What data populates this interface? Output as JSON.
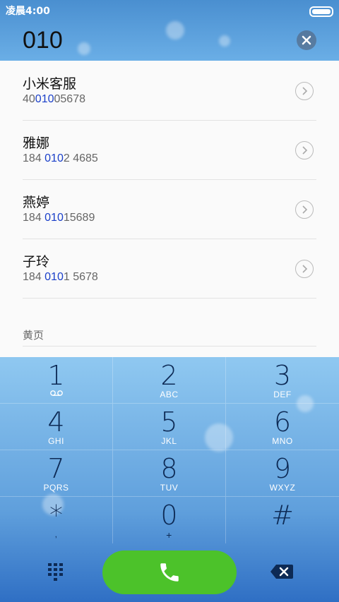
{
  "status": {
    "time": "凌晨4:00"
  },
  "dialer": {
    "number": "010"
  },
  "results": [
    {
      "name": "小米客服",
      "num_pre": "40",
      "num_hl": "010",
      "num_post": "05678"
    },
    {
      "name": "雅娜",
      "num_pre": "184 ",
      "num_hl": "010",
      "num_post": "2 4685"
    },
    {
      "name": "燕婷",
      "num_pre": "184 ",
      "num_hl": "010",
      "num_post": "15689"
    },
    {
      "name": "子玲",
      "num_pre": "184 ",
      "num_hl": "010",
      "num_post": "1 5678"
    }
  ],
  "yellow_pages": {
    "label": "黄页"
  },
  "keypad": [
    {
      "digit": "1",
      "letters": ""
    },
    {
      "digit": "2",
      "letters": "ABC"
    },
    {
      "digit": "3",
      "letters": "DEF"
    },
    {
      "digit": "4",
      "letters": "GHI"
    },
    {
      "digit": "5",
      "letters": "JKL"
    },
    {
      "digit": "6",
      "letters": "MNO"
    },
    {
      "digit": "7",
      "letters": "PQRS"
    },
    {
      "digit": "8",
      "letters": "TUV"
    },
    {
      "digit": "9",
      "letters": "WXYZ"
    },
    {
      "digit": "*",
      "letters": ","
    },
    {
      "digit": "0",
      "letters": "+"
    },
    {
      "digit": "#",
      "letters": ""
    }
  ],
  "icons": {
    "clear": "close-icon",
    "detail": "chevron-right-icon",
    "voicemail": "voicemail-icon",
    "dialpad": "dialpad-icon",
    "call": "phone-icon",
    "backspace": "backspace-icon"
  },
  "colors": {
    "highlight": "#1a3fc9",
    "call": "#4cc22a"
  }
}
